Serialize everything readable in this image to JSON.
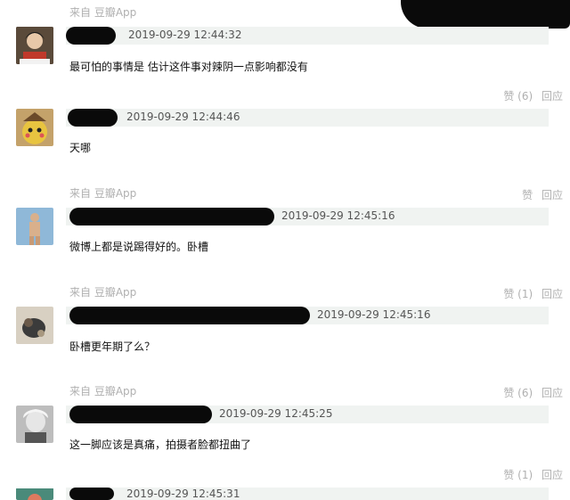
{
  "comments": [
    {
      "source": "来自 豆瓣App",
      "timestamp": "2019-09-29 12:44:32",
      "text": "最可怕的事情是 估计这件事对辣阴一点影响都没有",
      "like_label": "赞 (6)",
      "reply_label": "回应"
    },
    {
      "source": "",
      "timestamp": "2019-09-29 12:44:46",
      "text": "天哪",
      "like_label": "",
      "reply_label": ""
    },
    {
      "source": "来自 豆瓣App",
      "timestamp": "2019-09-29 12:45:16",
      "text": "微博上都是说踢得好的。卧槽",
      "like_label": "赞",
      "reply_label": "回应"
    },
    {
      "source": "来自 豆瓣App",
      "timestamp": "2019-09-29 12:45:16",
      "text": "卧槽更年期了么？",
      "like_label": "赞 (1)",
      "reply_label": "回应"
    },
    {
      "source": "来自 豆瓣App",
      "timestamp": "2019-09-29 12:45:25",
      "text": "这一脚应该是真痛，拍摄者脸都扭曲了",
      "like_label": "赞 (6)",
      "reply_label": "回应"
    },
    {
      "source": "",
      "timestamp": "2019-09-29 12:45:31",
      "text": "",
      "like_label": "赞 (1)",
      "reply_label": "回应"
    }
  ]
}
